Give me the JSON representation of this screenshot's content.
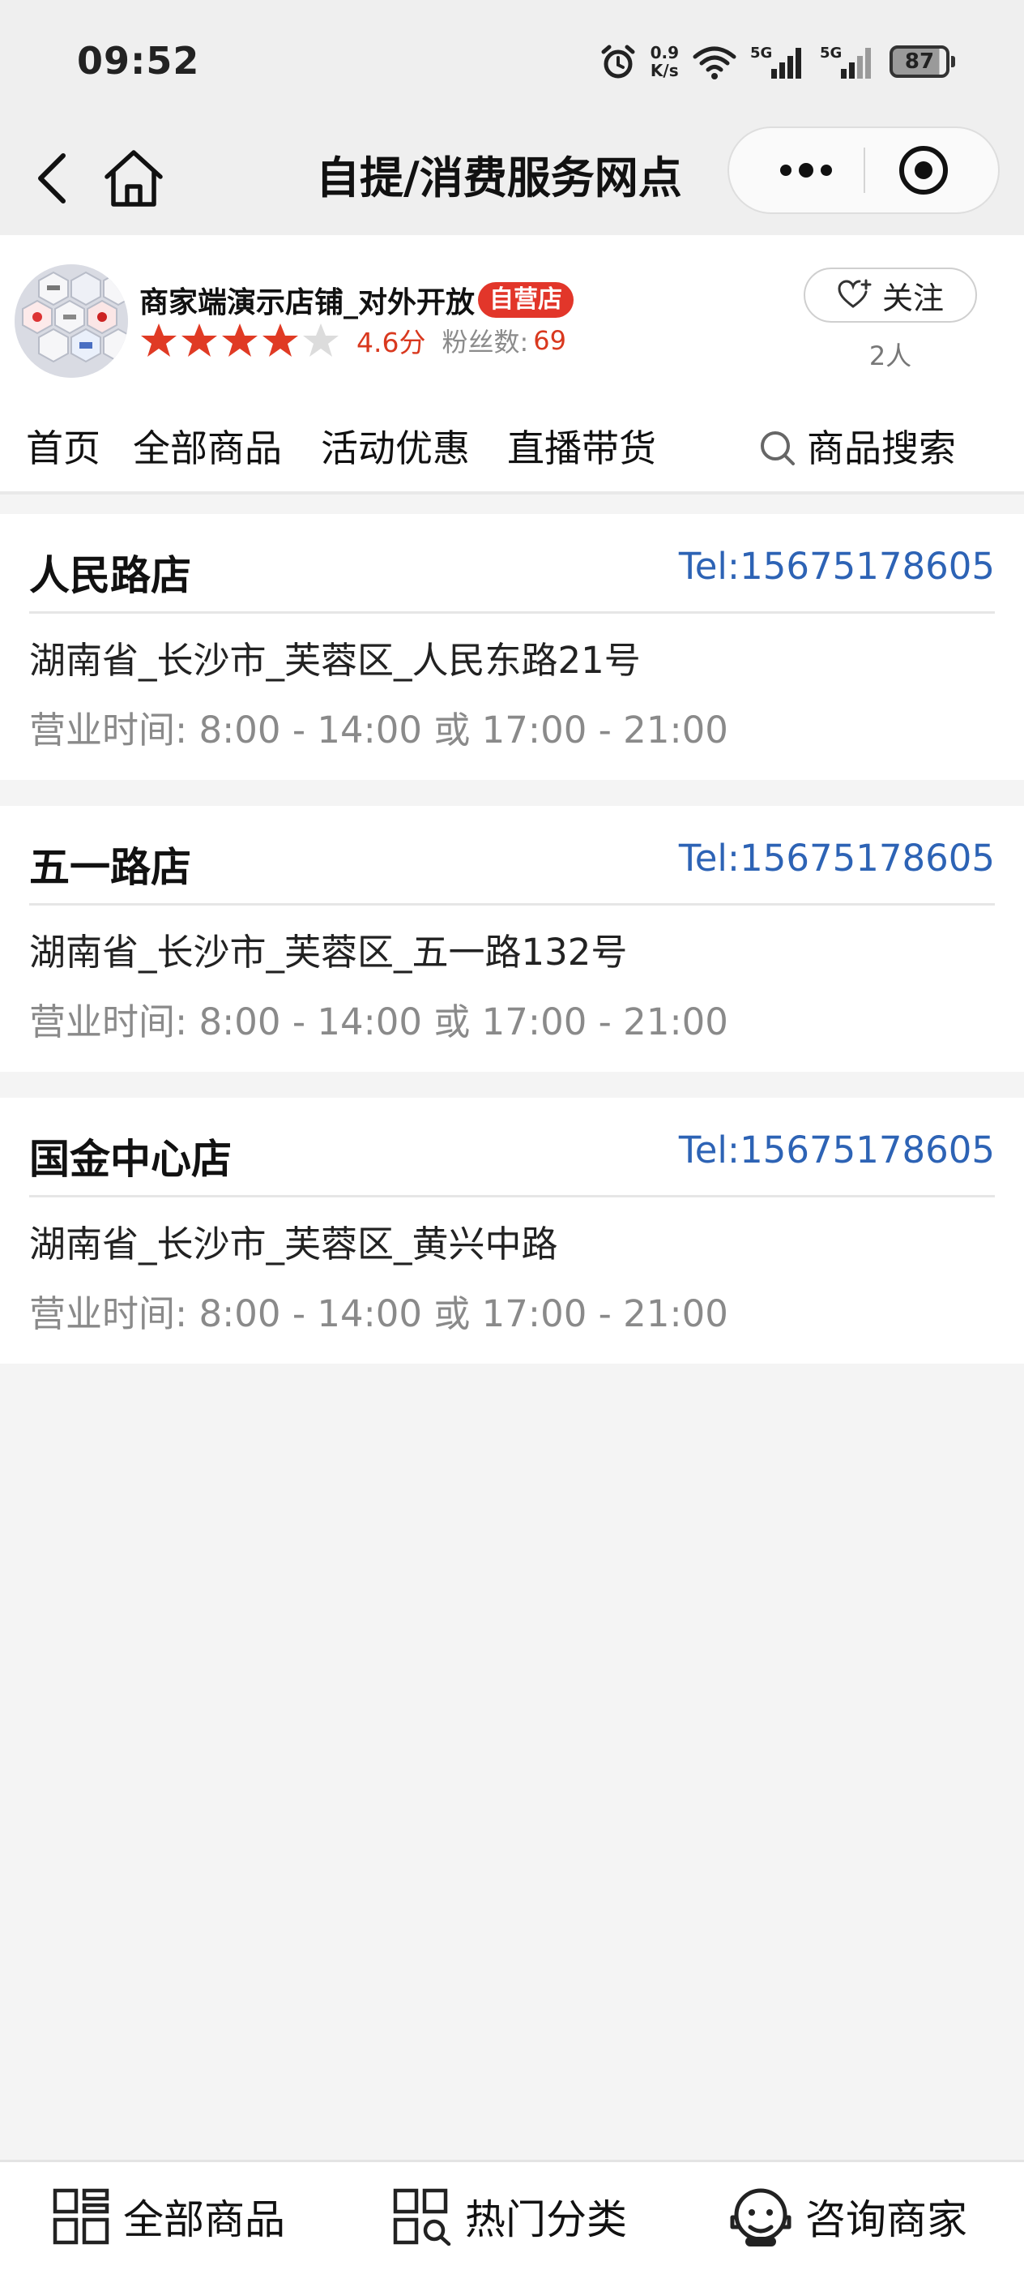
{
  "status_bar": {
    "time": "09:52",
    "net_speed_value": "0.9",
    "net_speed_unit": "K/s",
    "signal_1": "5G",
    "signal_2": "5G",
    "battery": "87"
  },
  "nav": {
    "title": "自提/消费服务网点",
    "icons": {
      "back": "back-arrow-icon",
      "home": "home-icon",
      "more": "more-dots-icon",
      "close": "close-miniprogram-icon"
    }
  },
  "store": {
    "name": "商家端演示店铺_对外开放",
    "badge": "自营店",
    "rating": 4.6,
    "rating_text": "4.6分",
    "stars_filled": 4,
    "stars_total": 5,
    "fans_label": "粉丝数:",
    "fans_count": "69",
    "follow_label": "关注",
    "follow_count": "2人",
    "tabs": [
      "首页",
      "全部商品",
      "活动优惠",
      "直播带货"
    ],
    "search_label": "商品搜索"
  },
  "outlets": [
    {
      "name": "人民路店",
      "tel": "Tel:15675178605",
      "address": "湖南省_长沙市_芙蓉区_人民东路21号",
      "hours": "营业时间: 8:00 - 14:00 或 17:00 - 21:00"
    },
    {
      "name": "五一路店",
      "tel": "Tel:15675178605",
      "address": "湖南省_长沙市_芙蓉区_五一路132号",
      "hours": "营业时间: 8:00 - 14:00 或 17:00 - 21:00"
    },
    {
      "name": "国金中心店",
      "tel": "Tel:15675178605",
      "address": "湖南省_长沙市_芙蓉区_黄兴中路",
      "hours": "营业时间: 8:00 - 14:00 或 17:00 - 21:00"
    }
  ],
  "bottom_bar": {
    "all_products": "全部商品",
    "hot_categories": "热门分类",
    "consult": "咨询商家"
  },
  "colors": {
    "accent_red": "#e2362a",
    "tel_blue": "#2d63b5",
    "page_bg": "#f4f4f4",
    "star_filled": "#e03a24",
    "star_empty": "#dcdcdc"
  }
}
